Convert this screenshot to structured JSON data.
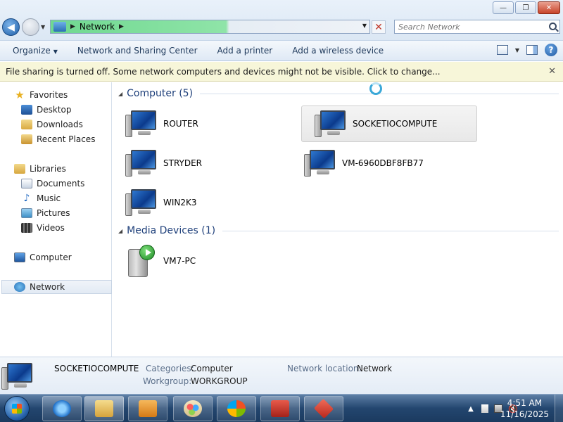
{
  "window": {
    "minimize_label": "—",
    "maximize_label": "❐",
    "close_label": "✕"
  },
  "address": {
    "path": [
      "Network"
    ],
    "stop_label": "✕"
  },
  "search": {
    "placeholder": "Search Network"
  },
  "toolbar": {
    "organize": "Organize",
    "network_sharing_center": "Network and Sharing Center",
    "add_printer": "Add a printer",
    "add_wireless": "Add a wireless device",
    "help": "?"
  },
  "infobar": {
    "message": "File sharing is turned off. Some network computers and devices might not be visible. Click to change...",
    "close": "✕"
  },
  "sidebar": {
    "favorites": "Favorites",
    "desktop": "Desktop",
    "downloads": "Downloads",
    "recent_places": "Recent Places",
    "libraries": "Libraries",
    "documents": "Documents",
    "music": "Music",
    "pictures": "Pictures",
    "videos": "Videos",
    "computer": "Computer",
    "network": "Network"
  },
  "groups": {
    "computer": {
      "title": "Computer (5)",
      "items": [
        "ROUTER",
        "SOCKETIOCOMPUTE",
        "STRYDER",
        "VM-6960DBF8FB77",
        "WIN2K3"
      ]
    },
    "media": {
      "title": "Media Devices (1)",
      "items": [
        "VM7-PC"
      ]
    }
  },
  "details": {
    "name": "SOCKETIOCOMPUTE",
    "categories_label": "Categories:",
    "categories_value": "Computer",
    "workgroup_label": "Workgroup:",
    "workgroup_value": "WORKGROUP",
    "location_label": "Network location:",
    "location_value": "Network"
  },
  "taskbar": {
    "time": "4:51 AM",
    "date": "11/16/2025"
  }
}
